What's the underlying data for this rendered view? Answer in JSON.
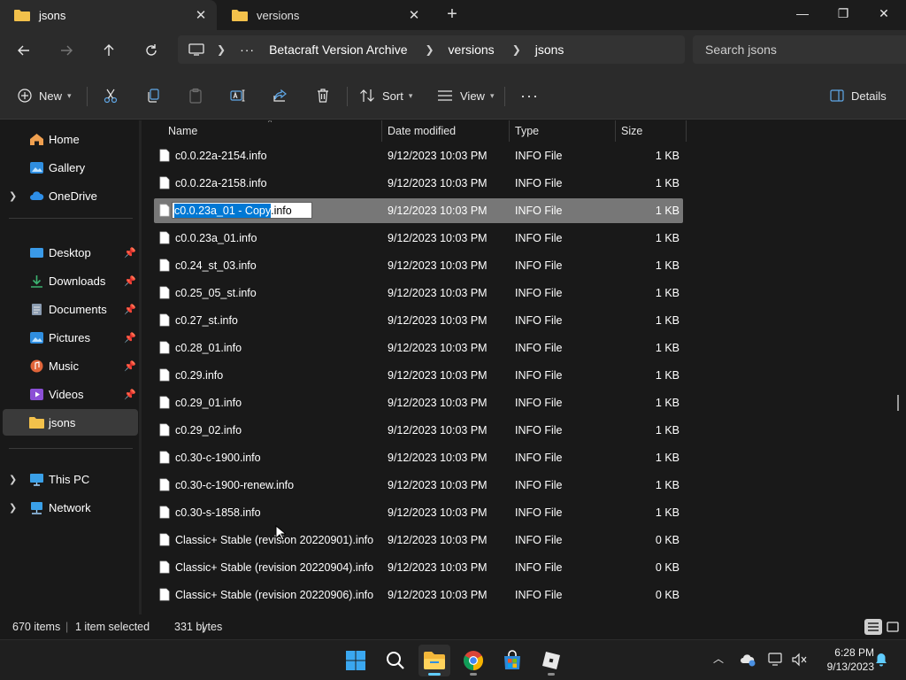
{
  "window": {
    "tabs": [
      {
        "label": "jsons",
        "active": true
      },
      {
        "label": "versions",
        "active": false
      }
    ],
    "new_tab": "+",
    "controls": {
      "minimize": "—",
      "maximize": "❐",
      "close": "✕"
    }
  },
  "address": {
    "ellipsis": "···",
    "breadcrumbs": [
      "Betacraft Version Archive",
      "versions",
      "jsons"
    ],
    "search_placeholder": "Search jsons"
  },
  "commands": {
    "new_label": "New",
    "sort_label": "Sort",
    "view_label": "View",
    "more": "···",
    "details_label": "Details"
  },
  "sidebar": {
    "home": "Home",
    "gallery": "Gallery",
    "onedrive": "OneDrive",
    "desktop": "Desktop",
    "downloads": "Downloads",
    "documents": "Documents",
    "pictures": "Pictures",
    "music": "Music",
    "videos": "Videos",
    "jsons": "jsons",
    "thispc": "This PC",
    "network": "Network"
  },
  "columns": {
    "name": "Name",
    "date": "Date modified",
    "type": "Type",
    "size": "Size"
  },
  "rename": {
    "selected_text": "c0.0.23a_01 - Copy",
    "extension": ".info"
  },
  "files": [
    {
      "name": "c0.0.22a-2154.info",
      "date": "9/12/2023 10:03 PM",
      "type": "INFO File",
      "size": "1 KB"
    },
    {
      "name": "c0.0.22a-2158.info",
      "date": "9/12/2023 10:03 PM",
      "type": "INFO File",
      "size": "1 KB"
    },
    {
      "name": "c0.0.23a_01 - Copy.info",
      "date": "9/12/2023 10:03 PM",
      "type": "INFO File",
      "size": "1 KB",
      "selected": true
    },
    {
      "name": "c0.0.23a_01.info",
      "date": "9/12/2023 10:03 PM",
      "type": "INFO File",
      "size": "1 KB"
    },
    {
      "name": "c0.24_st_03.info",
      "date": "9/12/2023 10:03 PM",
      "type": "INFO File",
      "size": "1 KB"
    },
    {
      "name": "c0.25_05_st.info",
      "date": "9/12/2023 10:03 PM",
      "type": "INFO File",
      "size": "1 KB"
    },
    {
      "name": "c0.27_st.info",
      "date": "9/12/2023 10:03 PM",
      "type": "INFO File",
      "size": "1 KB"
    },
    {
      "name": "c0.28_01.info",
      "date": "9/12/2023 10:03 PM",
      "type": "INFO File",
      "size": "1 KB"
    },
    {
      "name": "c0.29.info",
      "date": "9/12/2023 10:03 PM",
      "type": "INFO File",
      "size": "1 KB"
    },
    {
      "name": "c0.29_01.info",
      "date": "9/12/2023 10:03 PM",
      "type": "INFO File",
      "size": "1 KB"
    },
    {
      "name": "c0.29_02.info",
      "date": "9/12/2023 10:03 PM",
      "type": "INFO File",
      "size": "1 KB"
    },
    {
      "name": "c0.30-c-1900.info",
      "date": "9/12/2023 10:03 PM",
      "type": "INFO File",
      "size": "1 KB"
    },
    {
      "name": "c0.30-c-1900-renew.info",
      "date": "9/12/2023 10:03 PM",
      "type": "INFO File",
      "size": "1 KB"
    },
    {
      "name": "c0.30-s-1858.info",
      "date": "9/12/2023 10:03 PM",
      "type": "INFO File",
      "size": "1 KB"
    },
    {
      "name": "Classic+ Stable (revision 20220901).info",
      "date": "9/12/2023 10:03 PM",
      "type": "INFO File",
      "size": "0 KB"
    },
    {
      "name": "Classic+ Stable (revision 20220904).info",
      "date": "9/12/2023 10:03 PM",
      "type": "INFO File",
      "size": "0 KB"
    },
    {
      "name": "Classic+ Stable (revision 20220906).info",
      "date": "9/12/2023 10:03 PM",
      "type": "INFO File",
      "size": "0 KB"
    }
  ],
  "status": {
    "count": "670 items",
    "selection": "1 item selected",
    "size": "331 bytes"
  },
  "taskbar": {
    "time": "6:28 PM",
    "date": "9/13/2023"
  },
  "colors": {
    "accent": "#0078d4",
    "folder": "#f3c14b",
    "selected_row": "#777777",
    "background": "#191919",
    "chrome": "#2b2b2b"
  }
}
